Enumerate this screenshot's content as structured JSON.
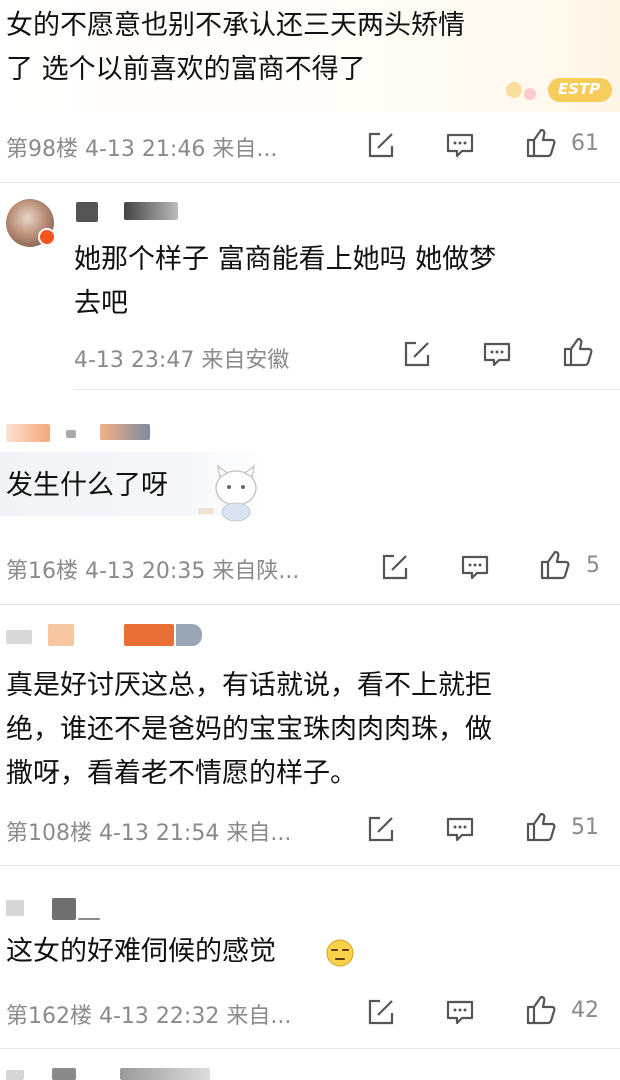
{
  "comments": [
    {
      "lines": [
        "女的不愿意也别不承认还三天两头矫情",
        "了 选个以前喜欢的富商不得了"
      ],
      "floor": "第98楼",
      "time": "4-13 21:46",
      "source": "来自...",
      "likes": "61",
      "badge_text": "ESTP"
    },
    {
      "lines": [
        "她那个样子 富商能看上她吗 她做梦",
        "去吧"
      ],
      "floor": "",
      "time": "4-13 23:47",
      "source": "来自安徽",
      "likes": ""
    },
    {
      "lines": [
        "发生什么了呀"
      ],
      "floor": "第16楼",
      "time": "4-13 20:35",
      "source": "来自陕...",
      "likes": "5"
    },
    {
      "lines": [
        "真是好讨厌这总，有话就说，看不上就拒",
        "绝，谁还不是爸妈的宝宝珠肉肉肉珠，做",
        "撒呀，看着老不情愿的样子。"
      ],
      "floor": "第108楼",
      "time": "4-13 21:54",
      "source": "来自...",
      "likes": "51"
    },
    {
      "lines": [
        "这女的好难伺候的感觉"
      ],
      "floor": "第162楼",
      "time": "4-13 22:32",
      "source": "来自...",
      "likes": "42"
    }
  ],
  "icons": {
    "edit": "share-edit-icon",
    "reply": "comment-icon",
    "like": "thumbs-up-icon",
    "emoji": "squint-face-emoji"
  },
  "colors": {
    "meta": "#8a8a8a",
    "divider": "#e6e6e6",
    "vbadge": "#f2561d",
    "blur_orange": "#f08a4b",
    "blur_gray": "#8c8c8c"
  }
}
